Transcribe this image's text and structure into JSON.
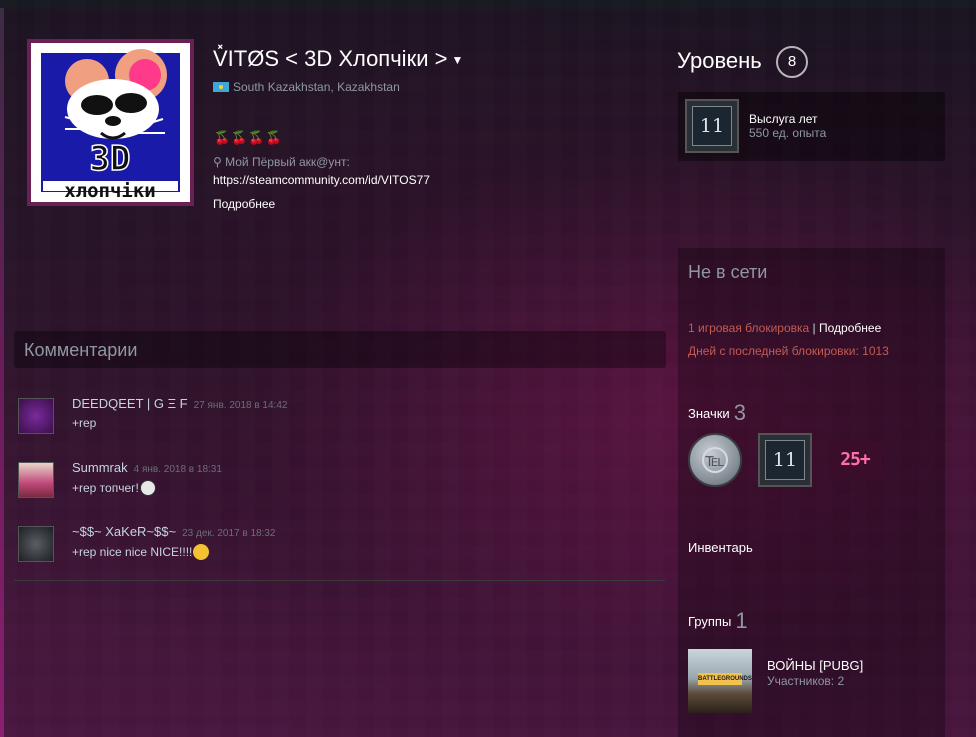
{
  "profile": {
    "persona_name": "V̽ITØS < 3D Хлопчіки >",
    "location": "South Kazakhstan, Kazakhstan",
    "cherries": "🍒🍒🍒🍒",
    "summary_line1": "Мой Пёрвый акк@унт:",
    "summary_url": "https://steamcommunity.com/id/VITOS77",
    "more_label": "Подробнее",
    "avatar_top_text": "3D",
    "avatar_bottom_text": "хлопчіки"
  },
  "comments": {
    "title": "Комментарии",
    "items": [
      {
        "author": "DEEDQEET | G Ξ F",
        "time": "27 янв. 2018 в 14:42",
        "text": "+rep"
      },
      {
        "author": "Summrak",
        "time": "4 янв. 2018 в 18:31",
        "text": "+rep топчег!"
      },
      {
        "author": "~$$~ XaKeR~$$~",
        "time": "23 дек. 2017 в 18:32",
        "text": "+rep nice nice NICE!!!!"
      }
    ]
  },
  "level": {
    "label": "Уровень",
    "value": "8",
    "badge_number": "11",
    "xp_badge_name": "Выслуга лет",
    "xp_points": "550 ед. опыта"
  },
  "sidebar": {
    "status": "Не в сети",
    "ban_text": "1 игровая блокировка",
    "ban_sep": "|",
    "ban_more": "Подробнее",
    "ban_days": "Дней с последней блокировки: 1013",
    "badges_label": "Значки",
    "badges_count": "3",
    "badge_25": "25+",
    "inventory_label": "Инвентарь",
    "groups_label": "Группы",
    "groups_count": "1",
    "group_name": "ВОЙНЫ [PUBG]",
    "group_members": "Участников: 2",
    "group_logo_text": "BATTLEGROUNDS"
  },
  "colors": {
    "ban_red": "#c45b52",
    "accent_magenta": "#6a1f55"
  }
}
